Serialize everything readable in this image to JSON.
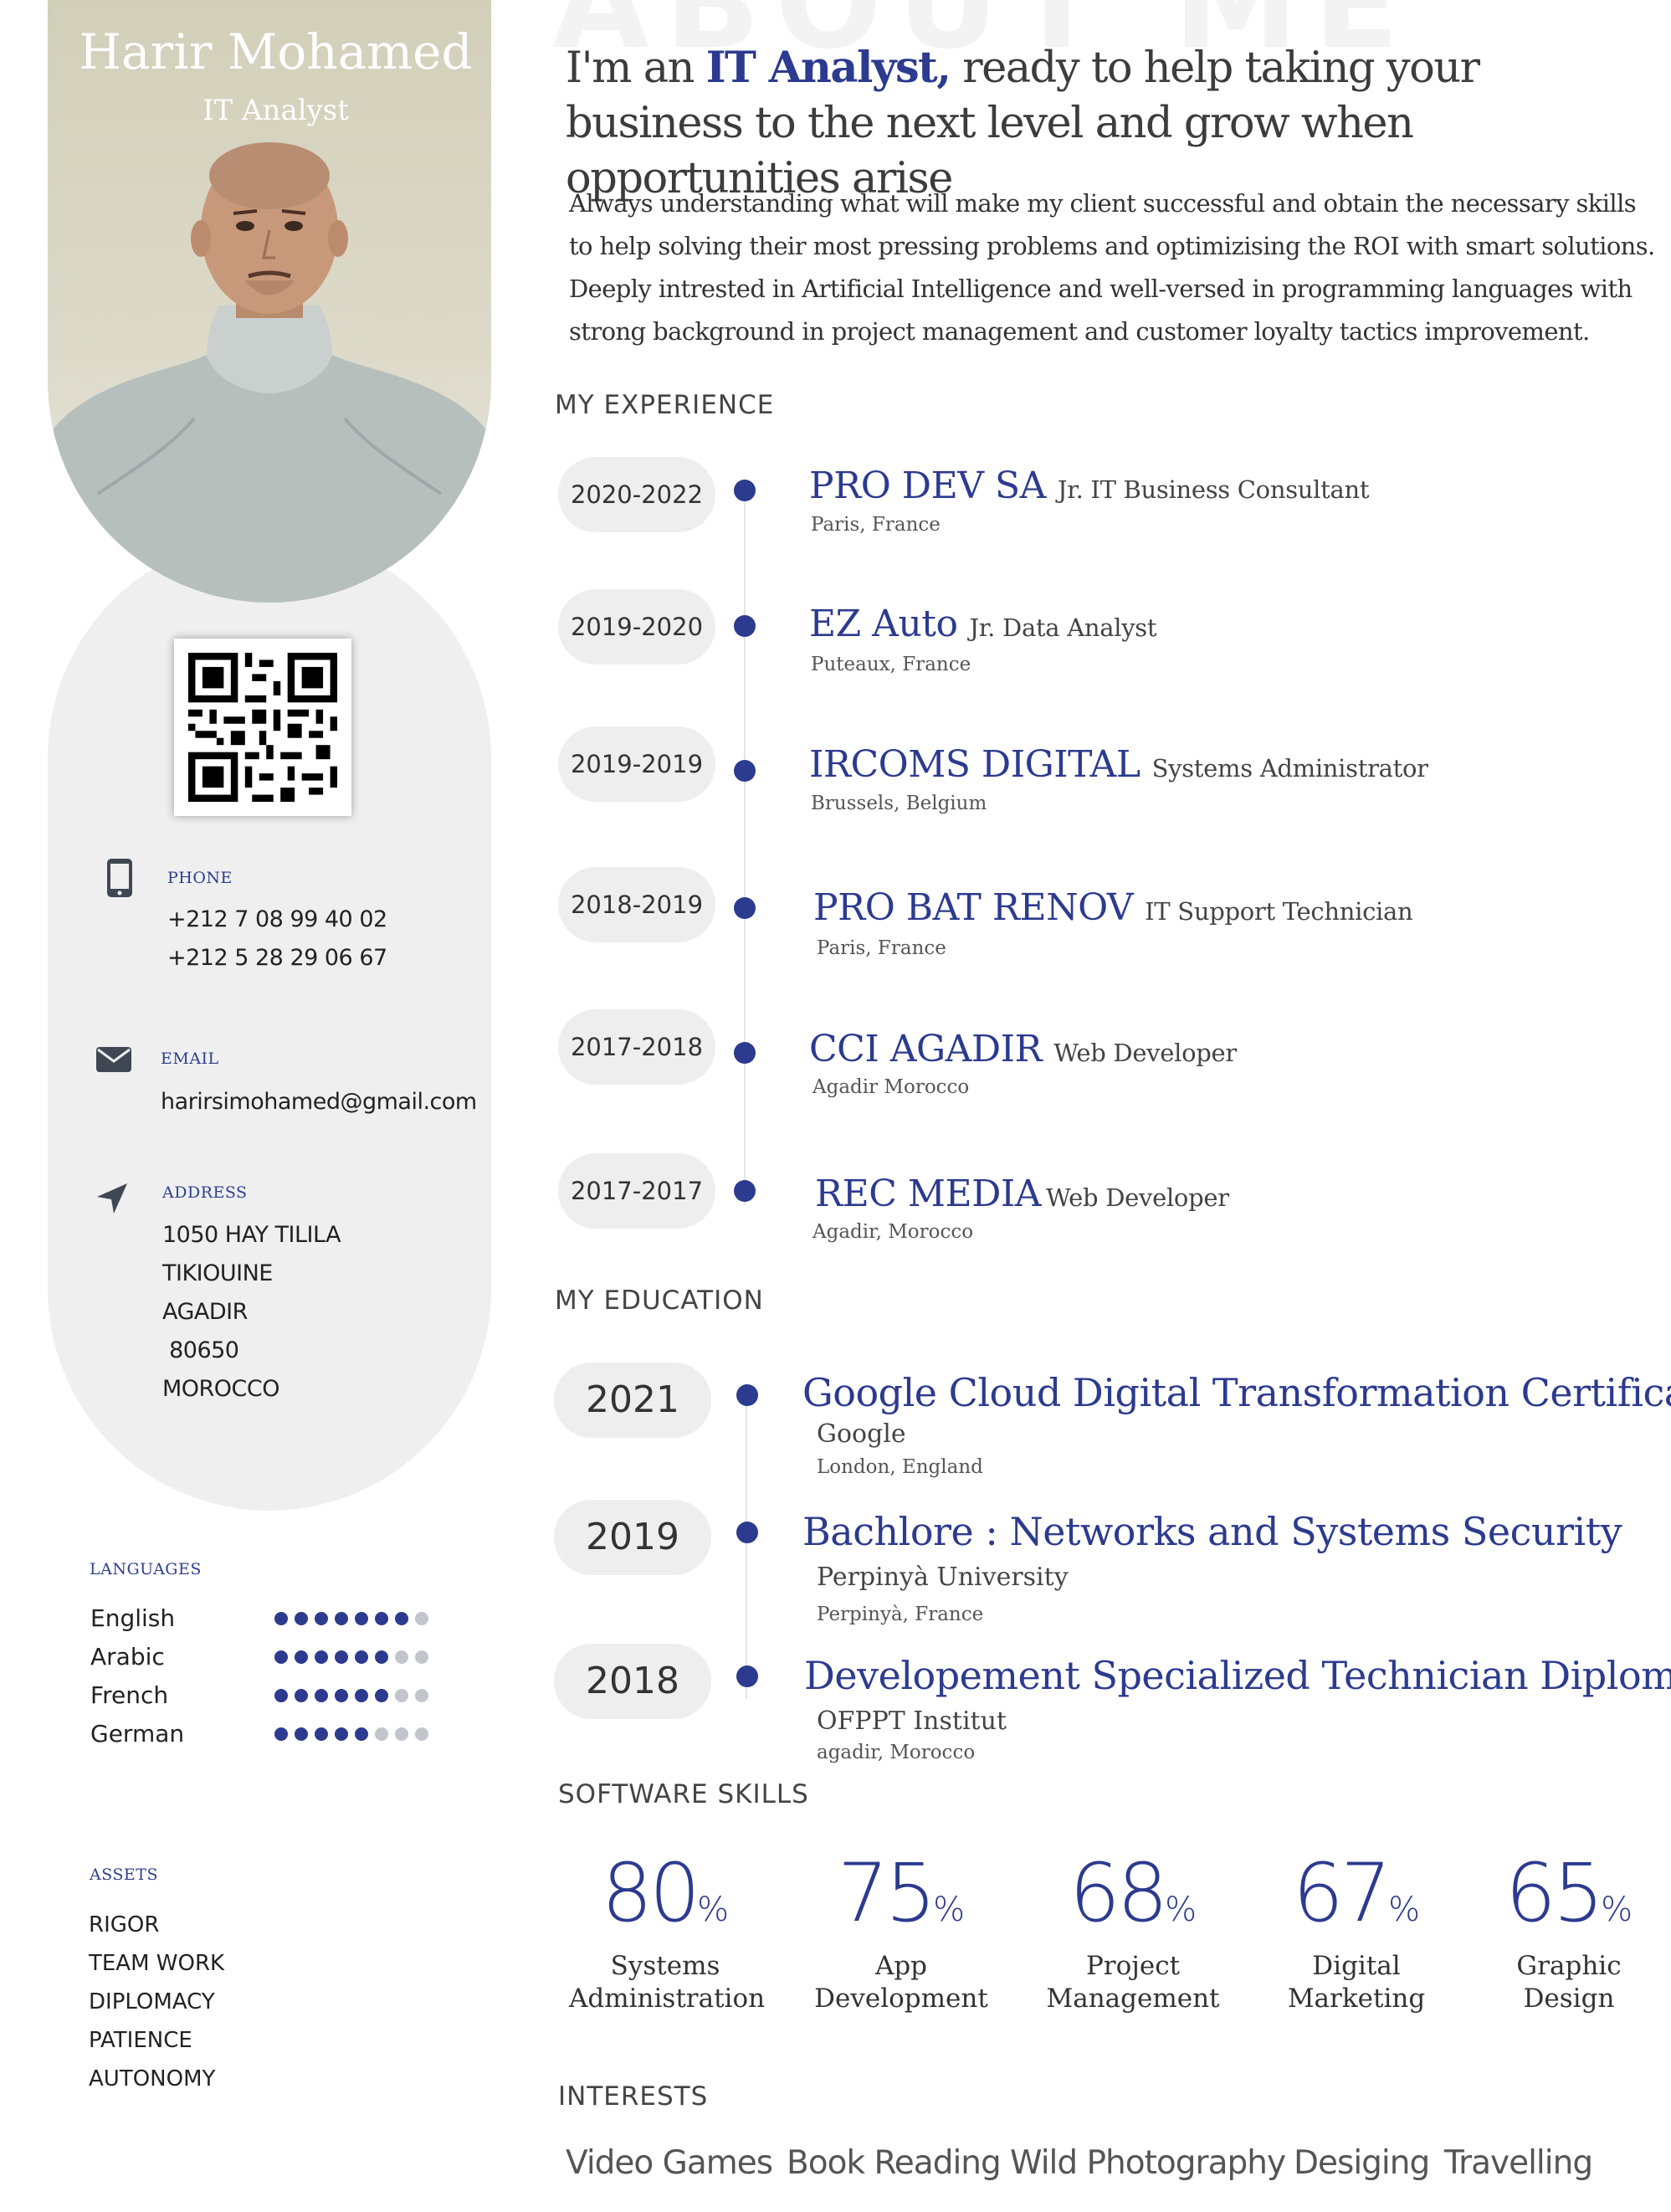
{
  "watermark": "ABOUT ME",
  "profile": {
    "name": "Harir Mohamed",
    "role": "IT Analyst"
  },
  "contact": {
    "phone_label": "PHONE",
    "phones": [
      "+212 7 08 99 40 02",
      "+212 5 28 29 06 67"
    ],
    "email_label": "EMAIL",
    "email": "harirsimohamed@gmail.com",
    "address_label": "ADDRESS",
    "address": [
      "1050 HAY TILILA",
      "TIKIOUINE",
      "AGADIR",
      " 80650",
      "MOROCCO"
    ]
  },
  "languages": {
    "heading": "LANGUAGES",
    "items": [
      {
        "name": "English",
        "level": 7
      },
      {
        "name": "Arabic",
        "level": 6
      },
      {
        "name": "French",
        "level": 6
      },
      {
        "name": "German",
        "level": 5
      }
    ],
    "max": 8
  },
  "assets": {
    "heading": "ASSETS",
    "items": [
      "RIGOR",
      "TEAM WORK",
      "DIPLOMACY",
      "PATIENCE",
      "AUTONOMY"
    ]
  },
  "intro": {
    "pre": "I'm an ",
    "highlight": "IT Analyst,",
    "post": " ready to help taking your business to the next level and grow when opportunities arise",
    "body": "Always understanding what will make my client successful and obtain the necessary skills to help solving their most pressing problems and optimizising the ROI with smart solutions. Deeply intrested in Artificial Intelligence and well-versed in programming languages with strong background in project management and customer loyalty tactics improvement."
  },
  "experience": {
    "heading": "MY EXPERIENCE",
    "items": [
      {
        "years": "2020-2022",
        "company": "PRO DEV SA",
        "role": "Jr. IT Business Consultant",
        "place": "Paris, France"
      },
      {
        "years": "2019-2020",
        "company": "EZ Auto",
        "role": "Jr. Data Analyst",
        "place": "Puteaux, France"
      },
      {
        "years": "2019-2019",
        "company": "IRCOMS DIGITAL",
        "role": "Systems Administrator",
        "place": "Brussels, Belgium"
      },
      {
        "years": "2018-2019",
        "company": "PRO BAT RENOV",
        "role": "IT Support Technician",
        "place": "Paris, France"
      },
      {
        "years": "2017-2018",
        "company": "CCI AGADIR",
        "role": "Web Developer",
        "place": "Agadir Morocco"
      },
      {
        "years": "2017-2017",
        "company": "REC MEDIA",
        "role": "Web Developer",
        "place": "Agadir, Morocco"
      }
    ]
  },
  "education": {
    "heading": "MY EDUCATION",
    "items": [
      {
        "year": "2021",
        "title": "Google Cloud Digital Transformation Certificate",
        "institution": "Google",
        "place": "London, England"
      },
      {
        "year": "2019",
        "title": "Bachlore : Networks and Systems Security",
        "institution": "Perpinyà University",
        "place": "Perpinyà, France"
      },
      {
        "year": "2018",
        "title": "Developement Specialized Technician Diploma",
        "institution": "OFPPT Institut",
        "place": "agadir, Morocco"
      }
    ]
  },
  "skills": {
    "heading": "SOFTWARE SKILLS",
    "percent_sign": "%",
    "items": [
      {
        "value": "80",
        "line1": "Systems",
        "line2": "Administration"
      },
      {
        "value": "75",
        "line1": "App",
        "line2": "Development"
      },
      {
        "value": "68",
        "line1": "Project",
        "line2": "Management"
      },
      {
        "value": "67",
        "line1": "Digital",
        "line2": "Marketing"
      },
      {
        "value": "65",
        "line1": "Graphic",
        "line2": "Design"
      }
    ]
  },
  "interests": {
    "heading": "INTERESTS",
    "items": [
      "Video Games",
      "Book Reading",
      "Wild Photography",
      "Desiging",
      "Travelling"
    ]
  },
  "colors": {
    "accent": "#2c3a8f",
    "sidebar": "#efefef",
    "pill": "#eeeeee",
    "dot_off": "#c2c6cc"
  },
  "icons": [
    "phone-icon",
    "email-icon",
    "location-arrow-icon",
    "qr-code"
  ]
}
